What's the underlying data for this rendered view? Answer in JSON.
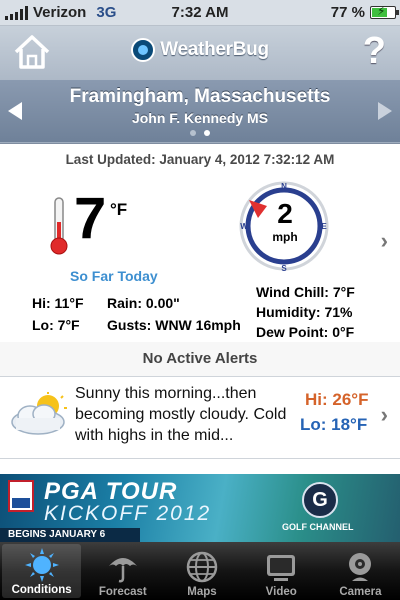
{
  "status_bar": {
    "carrier": "Verizon",
    "network": "3G",
    "time": "7:32 AM",
    "battery": "77 %",
    "battery_level": 0.77
  },
  "header": {
    "app_name": "WeatherBug",
    "help_label": "?",
    "location": "Framingham, Massachusetts",
    "station": "John F. Kennedy MS",
    "page_count": 2,
    "active_page": 2
  },
  "conditions": {
    "last_updated": "Last Updated: January 4, 2012 7:32:12 AM",
    "temperature": "7",
    "temp_unit": "°F",
    "wind_speed": "2",
    "wind_unit": "mph",
    "wind_direction": "W",
    "compass": {
      "n": "N",
      "e": "E",
      "s": "S",
      "w": "W"
    },
    "so_far_today": "So Far Today",
    "hi": "Hi: 11°F",
    "lo": "Lo: 7°F",
    "rain": "Rain: 0.00\"",
    "gusts": "Gusts: WNW 16mph",
    "wind_chill": "Wind Chill: 7°F",
    "humidity": "Humidity: 71%",
    "dew_point": "Dew Point: 0°F"
  },
  "alerts": {
    "text": "No Active Alerts"
  },
  "forecast": {
    "icon": "partly-cloudy-icon",
    "text": "Sunny this morning...then becoming mostly cloudy. Cold with highs in the mid...",
    "hi": "Hi: 26°F",
    "lo": "Lo: 18°F"
  },
  "ad": {
    "title": "PGA TOUR",
    "subtitle": "KICKOFF 2012",
    "date": "BEGINS JANUARY 6",
    "channel": "GOLF CHANNEL",
    "channel_mark": "G"
  },
  "tabs": [
    {
      "label": "Conditions",
      "icon": "sun-icon",
      "active": true
    },
    {
      "label": "Forecast",
      "icon": "umbrella-icon",
      "active": false
    },
    {
      "label": "Maps",
      "icon": "globe-icon",
      "active": false
    },
    {
      "label": "Video",
      "icon": "tv-icon",
      "active": false
    },
    {
      "label": "Camera",
      "icon": "webcam-icon",
      "active": false
    }
  ],
  "colors": {
    "accent_blue": "#3d8fd0",
    "forecast_hi": "#d5632a",
    "forecast_lo": "#2563b5",
    "compass_ring": "#2a3f8f",
    "wind_marker": "#e03030"
  }
}
